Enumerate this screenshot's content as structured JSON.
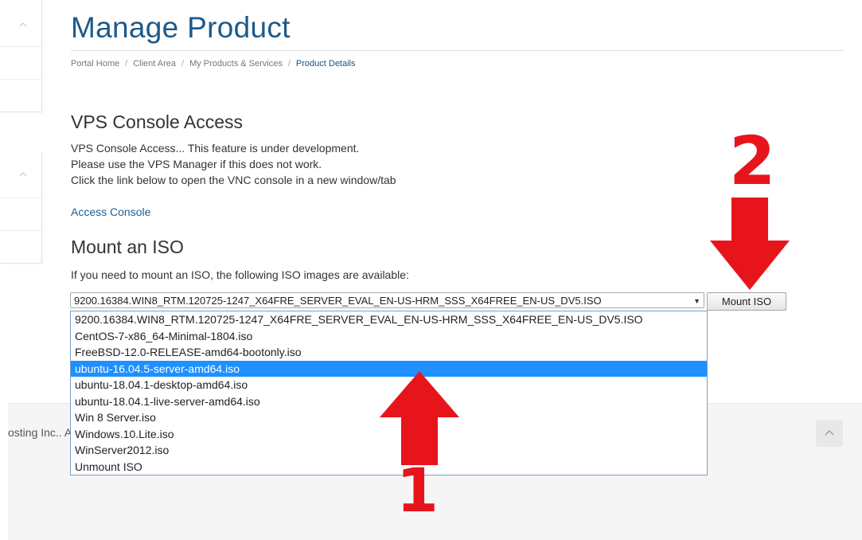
{
  "page": {
    "title": "Manage Product"
  },
  "breadcrumb": {
    "items": [
      "Portal Home",
      "Client Area",
      "My Products & Services"
    ],
    "active": "Product Details",
    "separator": "/"
  },
  "console": {
    "heading": "VPS Console Access",
    "line1": "VPS Console Access... This feature is under development.",
    "line2": "Please use the VPS Manager if this does not work.",
    "line3": "Click the link below to open the VNC console in a new window/tab",
    "link_label": "Access Console"
  },
  "iso": {
    "heading": "Mount an ISO",
    "description": "If you need to mount an ISO, the following ISO images are available:",
    "selected_value": "9200.16384.WIN8_RTM.120725-1247_X64FRE_SERVER_EVAL_EN-US-HRM_SSS_X64FREE_EN-US_DV5.ISO",
    "button_label": "Mount ISO",
    "options": [
      "9200.16384.WIN8_RTM.120725-1247_X64FRE_SERVER_EVAL_EN-US-HRM_SSS_X64FREE_EN-US_DV5.ISO",
      "CentOS-7-x86_64-Minimal-1804.iso",
      "FreeBSD-12.0-RELEASE-amd64-bootonly.iso",
      "ubuntu-16.04.5-server-amd64.iso",
      "ubuntu-18.04.1-desktop-amd64.iso",
      "ubuntu-18.04.1-live-server-amd64.iso",
      "Win 8 Server.iso",
      "Windows.10.Lite.iso",
      "WinServer2012.iso",
      "Unmount ISO"
    ],
    "highlighted_index": 3
  },
  "footer": {
    "text": "osting Inc.. A"
  },
  "annotations": {
    "step1": "1",
    "step2": "2",
    "color": "#e8141c"
  },
  "colors": {
    "title": "#1d5a8a",
    "link": "#1f5e8e",
    "highlight": "#1e90ff"
  }
}
